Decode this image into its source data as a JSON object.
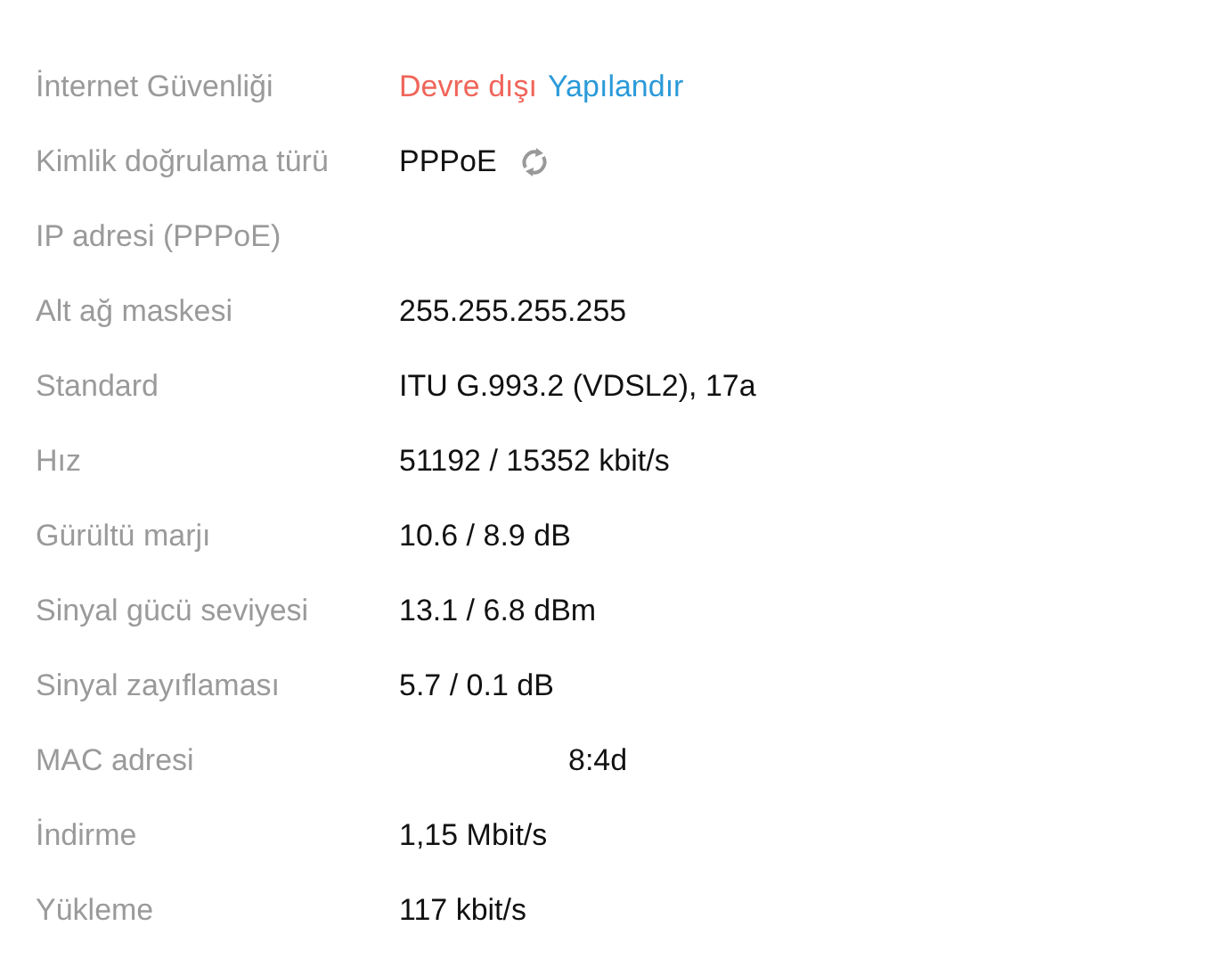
{
  "rows": [
    {
      "label": "İnternet Güvenliği",
      "kind": "status",
      "status": "Devre dışı",
      "link": "Yapılandır"
    },
    {
      "label": "Kimlik doğrulama türü",
      "kind": "refresh",
      "value": "PPPoE"
    },
    {
      "label": "IP adresi (PPPoE)",
      "kind": "text"
    },
    {
      "label": "Alt ağ maskesi",
      "kind": "text",
      "value": "255.255.255.255"
    },
    {
      "label": "Standard",
      "kind": "text",
      "value": "ITU G.993.2 (VDSL2), 17a"
    },
    {
      "label": "Hız",
      "kind": "text",
      "value": "51192 / 15352 kbit/s"
    },
    {
      "label": "Gürültü marjı",
      "kind": "text",
      "value": "10.6 / 8.9 dB"
    },
    {
      "label": "Sinyal gücü seviyesi",
      "kind": "text",
      "value": "13.1 / 6.8 dBm"
    },
    {
      "label": "Sinyal zayıflaması",
      "kind": "text",
      "value": "5.7 / 0.1 dB"
    },
    {
      "label": "MAC adresi",
      "kind": "partial",
      "value": "8:4d"
    },
    {
      "label": "İndirme",
      "kind": "text",
      "value": "1,15 Mbit/s"
    },
    {
      "label": "Yükleme",
      "kind": "text",
      "value": "117 kbit/s"
    }
  ]
}
